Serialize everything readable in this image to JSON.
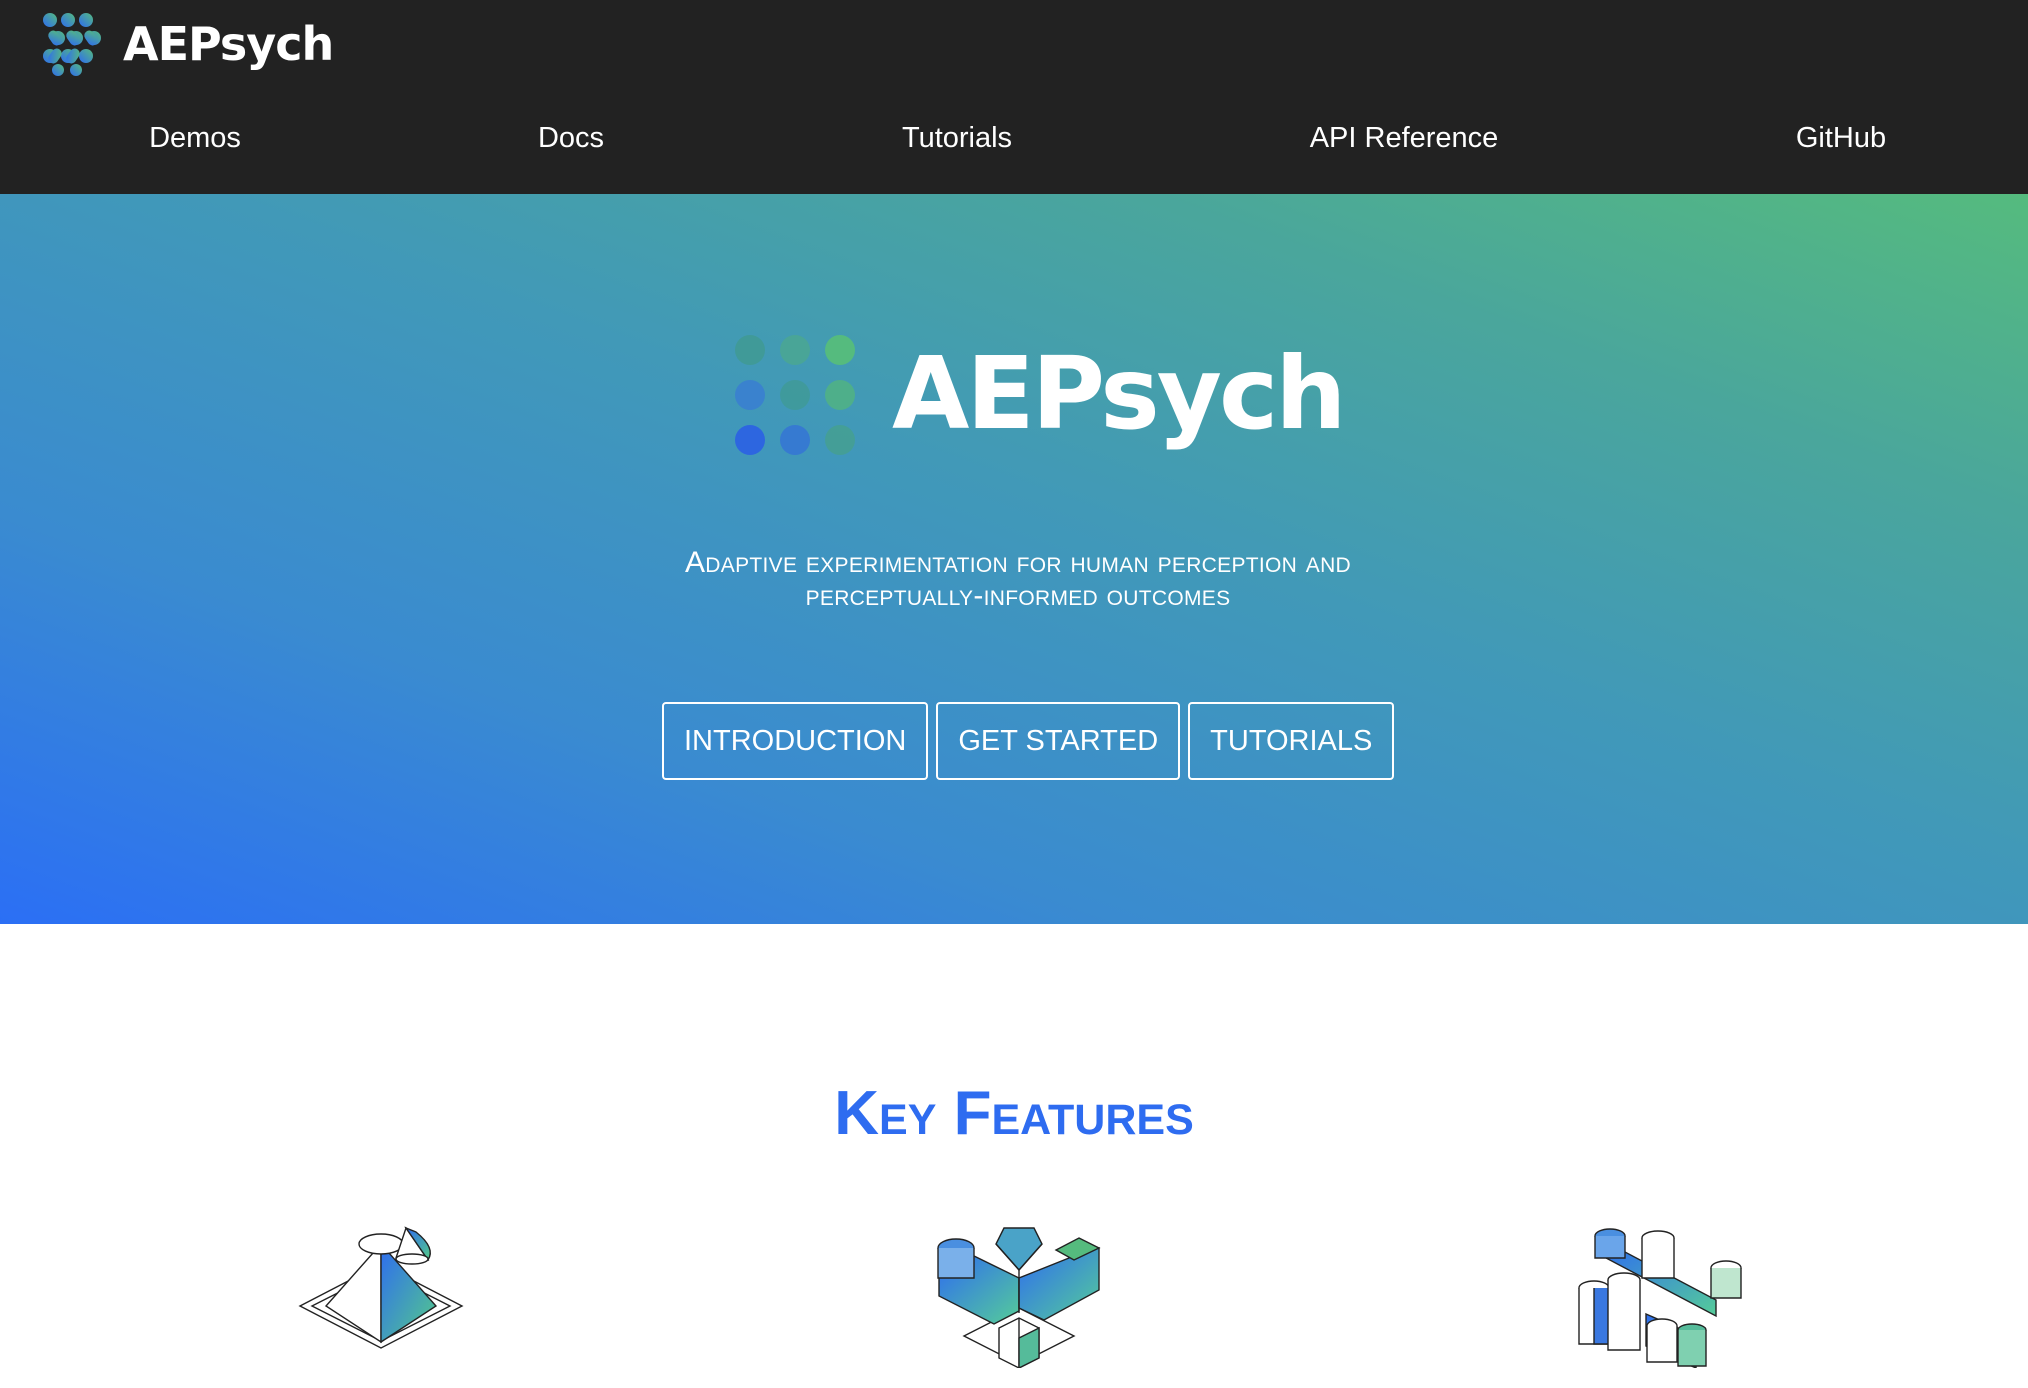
{
  "brand": {
    "name": "AEPsych",
    "logo_icon": "dot-grid-logo-icon"
  },
  "nav": {
    "items": [
      {
        "label": "Demos"
      },
      {
        "label": "Docs"
      },
      {
        "label": "Tutorials"
      },
      {
        "label": "API Reference"
      },
      {
        "label": "GitHub"
      }
    ]
  },
  "hero": {
    "title": "AEPsych",
    "tagline": "Adaptive experimentation for human perception and perceptually-informed outcomes",
    "buttons": [
      {
        "label": "INTRODUCTION"
      },
      {
        "label": "GET STARTED"
      },
      {
        "label": "TUTORIALS"
      }
    ],
    "gradient": {
      "start": "#2b6ff5",
      "end": "#55bb7e"
    }
  },
  "features": {
    "title": "Key Features",
    "icons": [
      "pyramid-cone-icon",
      "branching-blocks-icon",
      "cylinders-pipes-icon"
    ]
  },
  "colors": {
    "topbar": "#222222",
    "accent_blue": "#2e6cf0",
    "accent_green": "#55bb7e"
  }
}
